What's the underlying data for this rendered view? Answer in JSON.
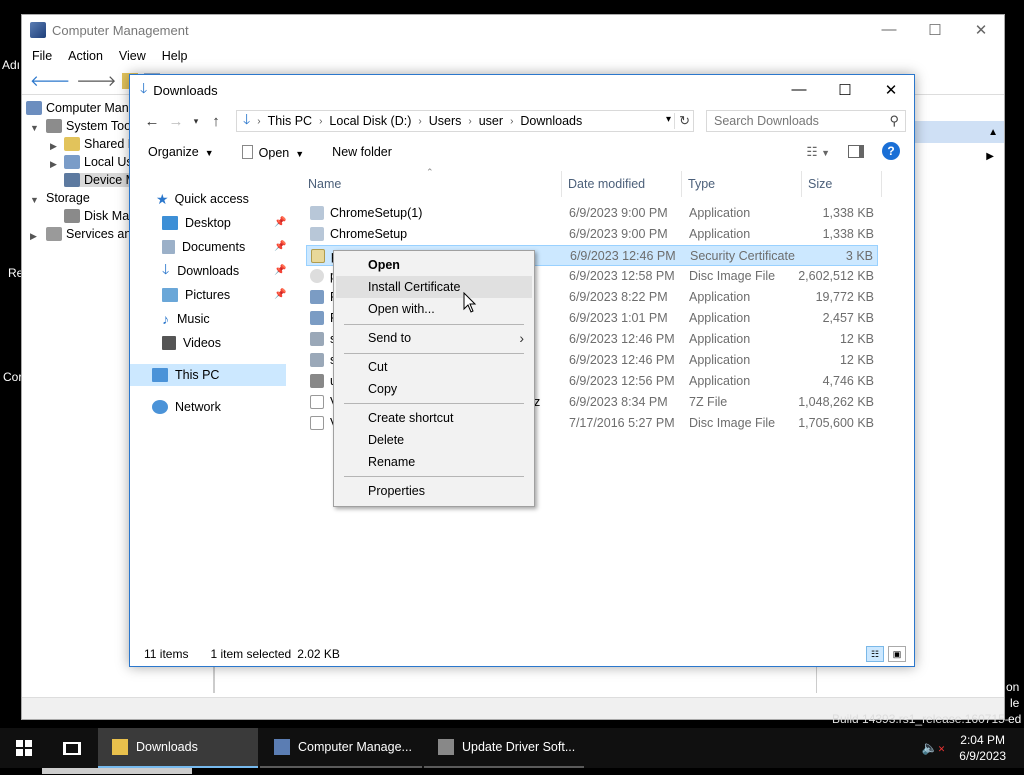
{
  "desktop": {
    "texts": [
      "Adı",
      "Re",
      "Cor",
      "Build 14393.rs1_release.160715-1616",
      "on",
      "le",
      "ed"
    ]
  },
  "cm": {
    "title": "Computer Management",
    "menu": [
      "File",
      "Action",
      "View",
      "Help"
    ],
    "tree": [
      "Computer Man",
      "System Tool",
      "Shared F",
      "Local Us",
      "Device M",
      "Storage",
      "Disk Mar",
      "Services and"
    ],
    "actions_fragment": "s"
  },
  "explorer": {
    "title": "Downloads",
    "address": {
      "crumbs": [
        "This PC",
        "Local Disk (D:)",
        "Users",
        "user",
        "Downloads"
      ]
    },
    "search_placeholder": "Search Downloads",
    "cmd": {
      "organize": "Organize",
      "open": "Open",
      "new_folder": "New folder"
    },
    "nav": {
      "quick_access": "Quick access",
      "desktop": "Desktop",
      "documents": "Documents",
      "downloads": "Downloads",
      "pictures": "Pictures",
      "music": "Music",
      "videos": "Videos",
      "this_pc": "This PC",
      "network": "Network"
    },
    "columns": {
      "name": "Name",
      "date": "Date modified",
      "type": "Type",
      "size": "Size"
    },
    "files": [
      {
        "name": "ChromeSetup(1)",
        "date": "6/9/2023 9:00 PM",
        "type": "Application",
        "size": "1,338 KB"
      },
      {
        "name": "ChromeSetup",
        "date": "6/9/2023 9:00 PM",
        "type": "Application",
        "size": "1,338 KB"
      },
      {
        "name": "p",
        "date": "6/9/2023 12:46 PM",
        "type": "Security Certificate",
        "size": "3 KB"
      },
      {
        "name": "p",
        "date": "6/9/2023 12:58 PM",
        "type": "Disc Image File",
        "size": "2,602,512 KB"
      },
      {
        "name": "P",
        "date": "6/9/2023 8:22 PM",
        "type": "Application",
        "size": "19,772 KB"
      },
      {
        "name": "R",
        "date": "6/9/2023 1:01 PM",
        "type": "Application",
        "size": "2,457 KB"
      },
      {
        "name": "s",
        "date": "6/9/2023 12:46 PM",
        "type": "Application",
        "size": "12 KB"
      },
      {
        "name": "s",
        "date": "6/9/2023 12:46 PM",
        "type": "Application",
        "size": "12 KB"
      },
      {
        "name": "u",
        "date": "6/9/2023 12:56 PM",
        "type": "Application",
        "size": "4,746 KB"
      },
      {
        "name": "V",
        "date": "6/9/2023 8:34 PM",
        "type": "7Z File",
        "size": "1,048,262 KB"
      },
      {
        "name": "V",
        "date": "7/17/2016 5:27 PM",
        "type": "Disc Image File",
        "size": "1,705,600 KB"
      }
    ],
    "row9_trailing": "z",
    "status": {
      "items": "11 items",
      "selected": "1 item selected",
      "size": "2.02 KB"
    }
  },
  "context_menu": {
    "open": "Open",
    "install_certificate": "Install Certificate",
    "open_with": "Open with...",
    "send_to": "Send to",
    "cut": "Cut",
    "copy": "Copy",
    "create_shortcut": "Create shortcut",
    "delete": "Delete",
    "rename": "Rename",
    "properties": "Properties"
  },
  "taskbar": {
    "apps": [
      "Downloads",
      "Computer Manage...",
      "Update Driver Soft..."
    ],
    "time": "2:04 PM",
    "date": "6/9/2023"
  },
  "colors": {
    "accent": "#2b77cc",
    "selection": "#cce8ff",
    "taskbar": "#101010"
  }
}
